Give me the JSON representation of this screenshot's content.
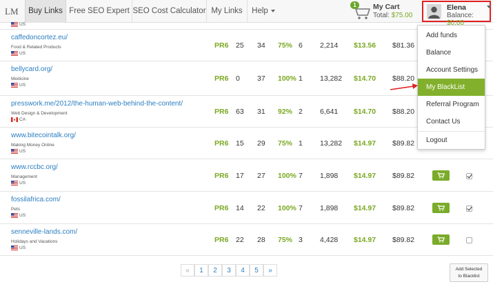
{
  "nav": {
    "logo": "LM",
    "items": [
      "Buy Links",
      "Free SEO Expert",
      "SEO Cost Calculator",
      "My Links",
      "Help"
    ]
  },
  "cart": {
    "count": "1",
    "title": "My Cart",
    "total_label": "Total: ",
    "total_value": "$75.00"
  },
  "user": {
    "name": "Elena",
    "balance_label": "Balance: ",
    "balance_value": "$0.00"
  },
  "dropdown": {
    "items": [
      "Add funds",
      "Balance",
      "Account Settings",
      "My BlackList",
      "Referral Program",
      "Contact Us",
      "Logout"
    ],
    "active_index": 3
  },
  "rows": [
    {
      "site": "caffedoncortez.eu/",
      "category": "Food & Related Products",
      "country": "US",
      "pr": "PR6",
      "c1": "25",
      "c2": "34",
      "pct": "75%",
      "c3": "6",
      "traffic": "2,214",
      "price": "$13.56",
      "price2": "$81.36",
      "checked": false
    },
    {
      "site": "bellycard.org/",
      "category": "Medicine",
      "country": "US",
      "pr": "PR6",
      "c1": "0",
      "c2": "37",
      "pct": "100%",
      "c3": "1",
      "traffic": "13,282",
      "price": "$14.70",
      "price2": "$88.20",
      "checked": false
    },
    {
      "site": "presswork.me/2012/the-human-web-behind-the-content/",
      "category": "Web Design & Development",
      "country": "CA",
      "pr": "PR6",
      "c1": "63",
      "c2": "31",
      "pct": "92%",
      "c3": "2",
      "traffic": "6,641",
      "price": "$14.70",
      "price2": "$88.20",
      "checked": false
    },
    {
      "site": "www.bitecointalk.org/",
      "category": "Making Money Online",
      "country": "US",
      "pr": "PR6",
      "c1": "15",
      "c2": "29",
      "pct": "75%",
      "c3": "1",
      "traffic": "13,282",
      "price": "$14.97",
      "price2": "$89.82",
      "checked": false
    },
    {
      "site": "www.rccbc.org/",
      "category": "Management",
      "country": "US",
      "pr": "PR6",
      "c1": "17",
      "c2": "27",
      "pct": "100%",
      "c3": "7",
      "traffic": "1,898",
      "price": "$14.97",
      "price2": "$89.82",
      "checked": true
    },
    {
      "site": "fossilafrica.com/",
      "category": "Pets",
      "country": "US",
      "pr": "PR6",
      "c1": "14",
      "c2": "22",
      "pct": "100%",
      "c3": "7",
      "traffic": "1,898",
      "price": "$14.97",
      "price2": "$89.82",
      "checked": true
    },
    {
      "site": "senneville-lands.com/",
      "category": "Holidays and Vacations",
      "country": "US",
      "pr": "PR6",
      "c1": "22",
      "c2": "28",
      "pct": "75%",
      "c3": "3",
      "traffic": "4,428",
      "price": "$14.97",
      "price2": "$89.82",
      "checked": false
    }
  ],
  "top_partial_country": "US",
  "pagination": {
    "prev": "«",
    "pages": [
      "1",
      "2",
      "3",
      "4",
      "5"
    ],
    "next": "»"
  },
  "add_blacklist": {
    "line1": "Add Selected",
    "line2": "to Blacklist"
  },
  "colors": {
    "accent_green": "#7aa823",
    "link_blue": "#2b7ec1",
    "highlight_red": "#e02020"
  }
}
